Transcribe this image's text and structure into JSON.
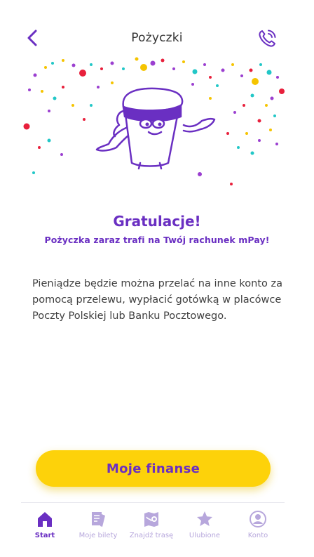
{
  "header": {
    "title": "Pożyczki",
    "back_icon": "chevron-left-icon",
    "action_icon": "phone-call-icon"
  },
  "success": {
    "heading": "Gratulacje!",
    "subheading": "Pożyczka zaraz trafi na Twój rachunek mPay!",
    "body": "Pieniądze będzie można przelać na inne konto za pomocą przelewu, wypłacić gotówką w placówce Poczty Polskiej lub Banku Pocztowego."
  },
  "cta": {
    "label": "Moje finanse"
  },
  "tabbar": {
    "items": [
      {
        "label": "Start",
        "icon": "home-icon",
        "active": true
      },
      {
        "label": "Moje bilety",
        "icon": "tickets-icon",
        "active": false
      },
      {
        "label": "Znajdź trasę",
        "icon": "route-map-icon",
        "active": false
      },
      {
        "label": "Ulubione",
        "icon": "star-icon",
        "active": false
      },
      {
        "label": "Konto",
        "icon": "account-icon",
        "active": false
      }
    ]
  },
  "colors": {
    "accent": "#6a2fc2",
    "cta_background": "#fdd20a",
    "inactive_tab": "#b7a7dc"
  }
}
